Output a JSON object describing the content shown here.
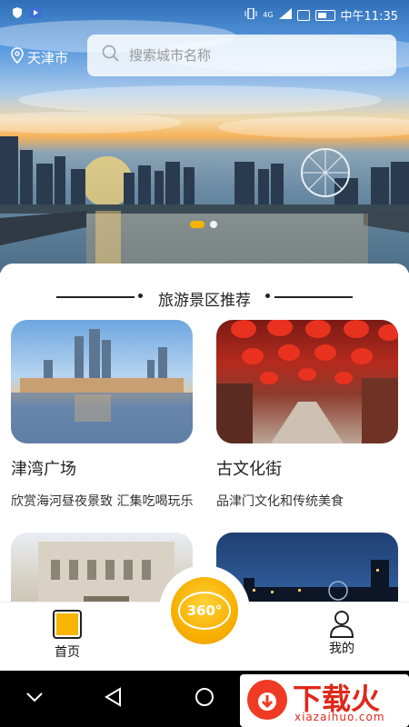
{
  "status": {
    "time": "中午11:35",
    "network": "4G"
  },
  "header": {
    "city": "天津市",
    "search_placeholder": "搜索城市名称"
  },
  "section": {
    "title": "旅游景区推荐"
  },
  "spots": [
    {
      "name": "津湾广场",
      "desc": "欣赏海河昼夜景致 汇集吃喝玩乐"
    },
    {
      "name": "古文化街",
      "desc": "品津门文化和传统美食"
    },
    {
      "name": "",
      "desc": ""
    },
    {
      "name": "",
      "desc": ""
    }
  ],
  "fab": {
    "label": "360°"
  },
  "tabs": {
    "home": "首页",
    "mine": "我的"
  },
  "watermark": {
    "brand": "下载火",
    "site": "xiazaihuo.com"
  },
  "colors": {
    "accent": "#f7b500",
    "text": "#222222"
  }
}
